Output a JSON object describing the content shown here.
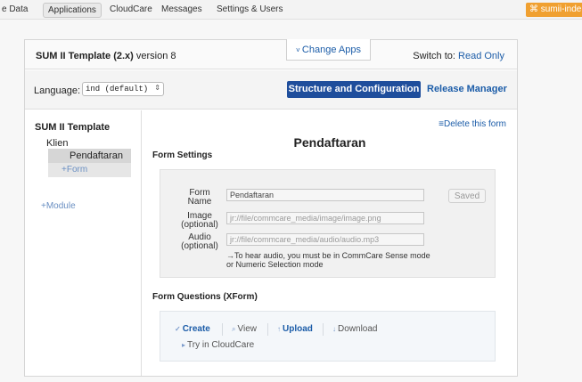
{
  "topnav": {
    "items": [
      "e Data",
      "Applications",
      "CloudCare",
      "Messages",
      "Settings & Users"
    ],
    "active": "Applications",
    "user": "sumii-inde"
  },
  "header": {
    "app_name": "SUM II Template (2.x)",
    "version_text": "version 8",
    "change_apps": "Change Apps",
    "switch_to_label": "Switch to:",
    "switch_to_link": "Read Only"
  },
  "language_bar": {
    "label": "Language:",
    "selected": "ind (default)",
    "structure_button": "Structure and Configuration",
    "release_manager": "Release Manager"
  },
  "sidebar": {
    "app_title": "SUM II Template",
    "module": "Klien",
    "form_active": "Pendaftaran",
    "add_form": "Form",
    "add_module": "Module"
  },
  "main": {
    "delete_form": "Delete this form",
    "title": "Pendaftaran",
    "form_settings_title": "Form Settings",
    "form_name_label": "Form Name",
    "form_name_value": "Pendaftaran",
    "saved_button": "Saved",
    "image_label": "Image (optional)",
    "image_value": "jr://file/commcare_media/image/image.png",
    "audio_label": "Audio (optional)",
    "audio_value": "jr://file/commcare_media/audio/audio.mp3",
    "audio_note": "To hear audio, you must be in CommCare Sense mode or Numeric Selection mode",
    "form_questions_title": "Form Questions (XForm)",
    "actions": {
      "create": "Create",
      "view": "View",
      "upload": "Upload",
      "download": "Download",
      "try": "Try in CloudCare"
    }
  },
  "colors": {
    "link": "#1b5ca8",
    "primary_button": "#1f4e9c",
    "user_badge": "#f0a030"
  }
}
